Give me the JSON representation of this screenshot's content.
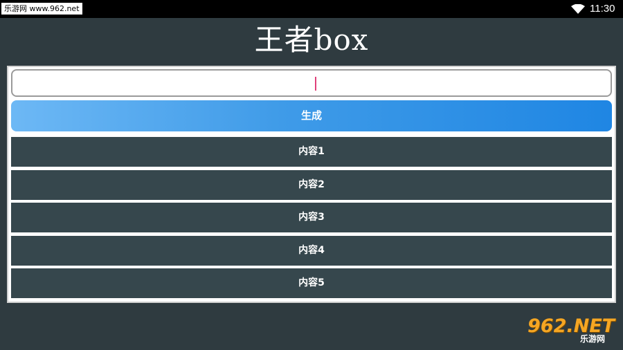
{
  "status_bar": {
    "watermark": "乐游网 www.962.net",
    "time": "11:30"
  },
  "app": {
    "title": "王者box"
  },
  "input": {
    "value": ""
  },
  "generate_button": {
    "label": "生成"
  },
  "content_items": [
    "内容1",
    "内容2",
    "内容3",
    "内容4",
    "内容5"
  ],
  "logo": {
    "main": "962.NET",
    "sub": "乐游网"
  },
  "colors": {
    "background": "#2f3b40",
    "item_background": "#36474d",
    "button_gradient_start": "#6db8f5",
    "button_gradient_end": "#1f86e3"
  }
}
